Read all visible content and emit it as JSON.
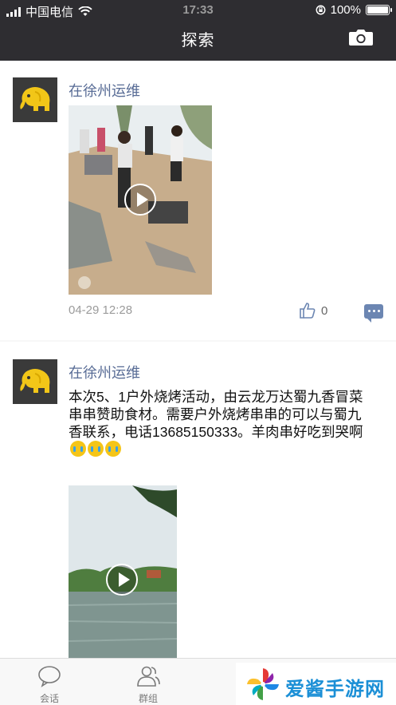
{
  "status": {
    "carrier": "中国电信",
    "time": "17:33",
    "battery": "100%"
  },
  "header": {
    "title": "探索"
  },
  "posts": [
    {
      "author": "在徐州运维",
      "text": "",
      "time": "04-29 12:28",
      "likes": "0"
    },
    {
      "author": "在徐州运维",
      "text": "本次5、1户外烧烤活动，由云龙万达蜀九香冒菜串串赞助食材。需要户外烧烤串串的可以与蜀九香联系，电话13685150333。羊肉串好吃到哭啊"
    }
  ],
  "tabs": [
    {
      "label": "会话"
    },
    {
      "label": "群组"
    }
  ],
  "watermark": {
    "text": "爱酱手游网"
  },
  "colors": {
    "nav_bg": "#2e2d31",
    "author": "#576b95",
    "accent": "#6c86b2"
  }
}
